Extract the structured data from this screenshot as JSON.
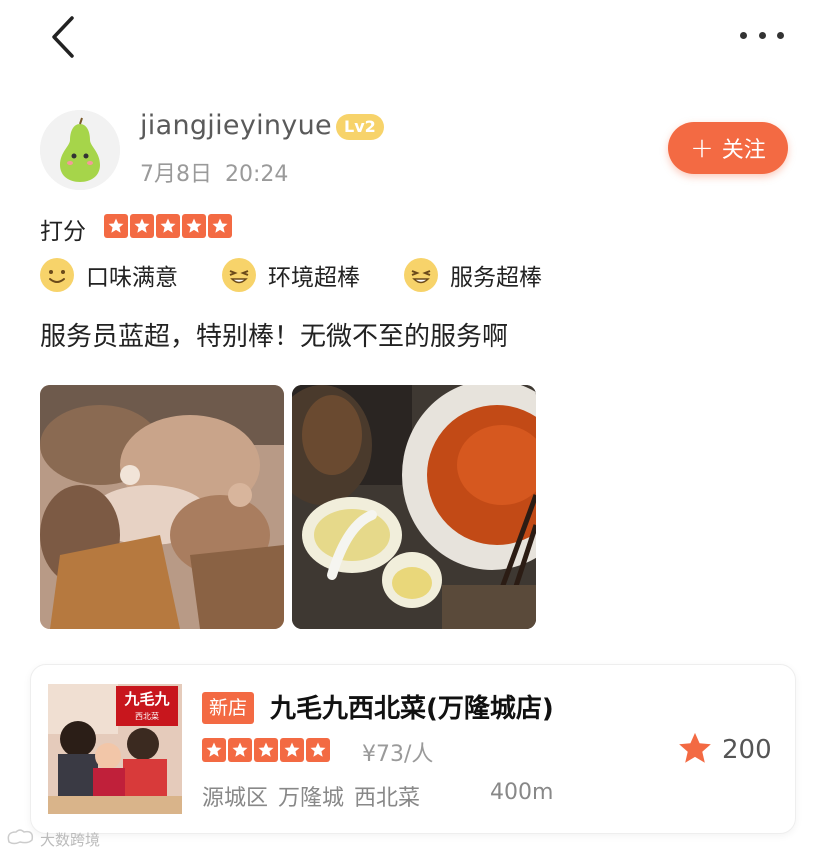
{
  "user": {
    "name": "jiangjieyinyue",
    "level": "Lv2",
    "date": "7月8日",
    "time": "20:24",
    "avatar_icon": "pear-avatar"
  },
  "follow_button": {
    "label": "关注",
    "icon": "plus-icon"
  },
  "rating": {
    "label": "打分",
    "stars": 5,
    "max": 5
  },
  "tags": [
    {
      "label": "口味满意",
      "icon": "smile-face-icon"
    },
    {
      "label": "环境超棒",
      "icon": "grin-face-icon"
    },
    {
      "label": "服务超棒",
      "icon": "grin-face-icon"
    }
  ],
  "review_text": "服务员蓝超，特别棒！无微不至的服务啊",
  "photos": [
    {
      "icon": "food-photo"
    },
    {
      "icon": "dishes-photo"
    }
  ],
  "shop": {
    "badge": "新店",
    "name": "九毛九西北菜(万隆城店)",
    "logo_text": "九毛九",
    "logo_sub": "西北菜",
    "stars": 5,
    "price": "¥73/人",
    "favorites": "200",
    "district": "源城区",
    "area": "万隆城",
    "cuisine": "西北菜",
    "distance": "400m"
  },
  "watermark": "大数跨境",
  "colors": {
    "accent": "#f36a43",
    "level_badge": "#f7d36a",
    "star": "#f36a43"
  }
}
